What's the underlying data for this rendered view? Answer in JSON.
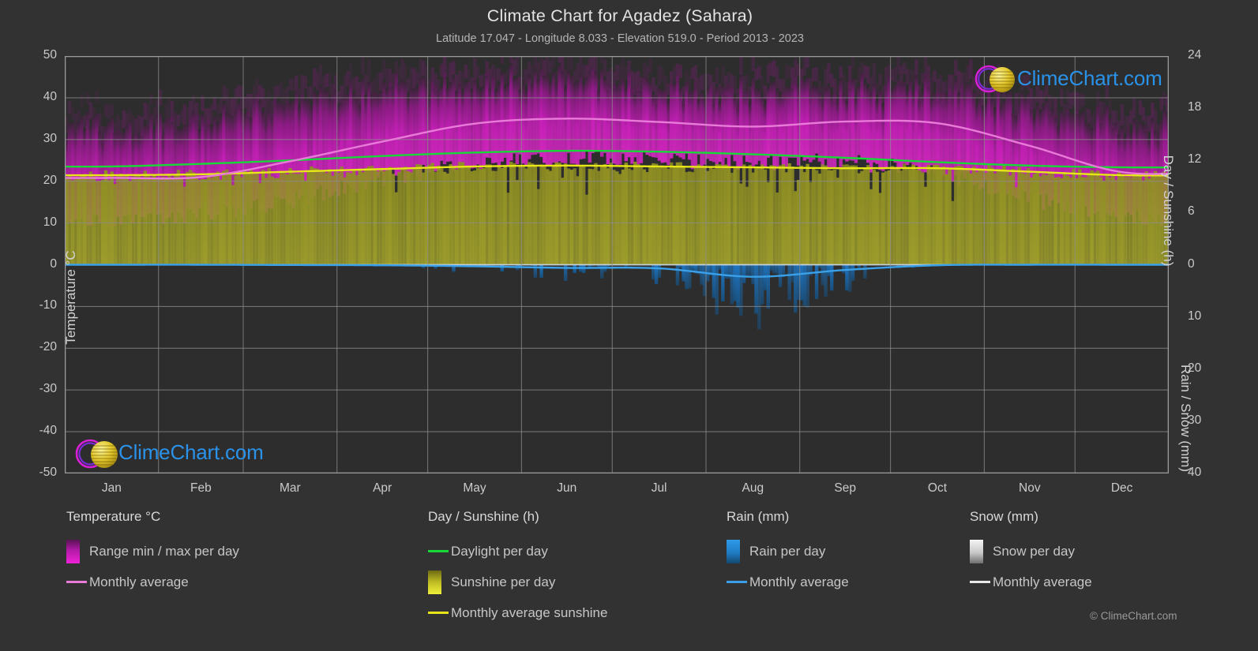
{
  "header": {
    "title": "Climate Chart for Agadez (Sahara)",
    "subtitle": "Latitude 17.047 - Longitude 8.033 - Elevation 519.0 - Period 2013 - 2023"
  },
  "axes": {
    "left_title": "Temperature °C",
    "right_top_title": "Day / Sunshine (h)",
    "right_bottom_title": "Rain / Snow (mm)",
    "left_ticks": [
      "50",
      "40",
      "30",
      "20",
      "10",
      "0",
      "-10",
      "-20",
      "-30",
      "-40",
      "-50"
    ],
    "right_top_ticks": [
      "24",
      "18",
      "12",
      "6",
      "0"
    ],
    "right_bottom_ticks": [
      "10",
      "20",
      "30",
      "40"
    ],
    "x_ticks": [
      "Jan",
      "Feb",
      "Mar",
      "Apr",
      "May",
      "Jun",
      "Jul",
      "Aug",
      "Sep",
      "Oct",
      "Nov",
      "Dec"
    ]
  },
  "legend": {
    "groups": [
      {
        "heading": "Temperature °C",
        "items": [
          {
            "label": "Range min / max per day",
            "swatch": "gradient-magenta",
            "type": "box"
          },
          {
            "label": "Monthly average",
            "swatch": "#e87ad8",
            "type": "line"
          }
        ]
      },
      {
        "heading": "Day / Sunshine (h)",
        "items": [
          {
            "label": "Daylight per day",
            "swatch": "#18d838",
            "type": "line"
          },
          {
            "label": "Sunshine per day",
            "swatch": "gradient-yellow",
            "type": "box"
          },
          {
            "label": "Monthly average sunshine",
            "swatch": "#e6e618",
            "type": "line"
          }
        ]
      },
      {
        "heading": "Rain (mm)",
        "items": [
          {
            "label": "Rain per day",
            "swatch": "gradient-blue",
            "type": "box"
          },
          {
            "label": "Monthly average",
            "swatch": "#3aa0e8",
            "type": "line"
          }
        ]
      },
      {
        "heading": "Snow (mm)",
        "items": [
          {
            "label": "Snow per day",
            "swatch": "gradient-white",
            "type": "box"
          },
          {
            "label": "Monthly average",
            "swatch": "#e8e8e8",
            "type": "line"
          }
        ]
      }
    ]
  },
  "branding": {
    "logo_text": "ClimeChart.com",
    "copyright": "© ClimeChart.com"
  },
  "colors": {
    "background": "#323232",
    "plot_background": "#2d2d2d",
    "grid": "#8c8c8c",
    "temp_range": "#cc22bb",
    "temp_avg_line": "#e87ad8",
    "daylight_line": "#18d838",
    "sunshine_fill": "#9a9a28",
    "sunshine_line": "#e6e618",
    "rain": "#1a7ac8",
    "rain_avg_line": "#3aa0e8",
    "snow": "#dcdcdc",
    "text": "#c8c8c8"
  },
  "chart_data": {
    "type": "area",
    "title": "Climate Chart for Agadez (Sahara)",
    "subtitle": "Latitude 17.047 - Longitude 8.033 - Elevation 519.0 - Period 2013 - 2023",
    "xlabel": "",
    "ylabel": "Temperature °C",
    "y2label_top": "Day / Sunshine (h)",
    "y2label_bottom": "Rain / Snow (mm)",
    "ylim": [
      -50,
      50
    ],
    "y2lim_top": [
      0,
      24
    ],
    "y2lim_bottom": [
      0,
      40
    ],
    "grid": true,
    "legend_position": "below",
    "categories": [
      "Jan",
      "Feb",
      "Mar",
      "Apr",
      "May",
      "Jun",
      "Jul",
      "Aug",
      "Sep",
      "Oct",
      "Nov",
      "Dec"
    ],
    "series": [
      {
        "name": "Monthly average temperature (°C)",
        "unit": "°C",
        "axis": "left",
        "values": [
          20.8,
          21.0,
          24.8,
          29.5,
          33.8,
          35.0,
          34.2,
          33.1,
          34.3,
          33.9,
          28.5,
          22.2
        ]
      },
      {
        "name": "Daily maximum temperature range top (°C)",
        "unit": "°C",
        "axis": "left",
        "values": [
          33.0,
          35.0,
          38.5,
          42.0,
          44.0,
          44.5,
          42.5,
          41.0,
          42.0,
          41.5,
          37.5,
          33.5
        ]
      },
      {
        "name": "Daily minimum temperature range bottom (°C)",
        "unit": "°C",
        "axis": "left",
        "values": [
          10.5,
          12.0,
          15.5,
          20.5,
          24.0,
          25.5,
          25.0,
          24.5,
          24.5,
          22.0,
          16.0,
          11.5
        ]
      },
      {
        "name": "Daylight per day (h)",
        "unit": "h",
        "axis": "right-top",
        "values": [
          11.3,
          11.6,
          12.0,
          12.5,
          12.9,
          13.1,
          13.0,
          12.7,
          12.3,
          11.8,
          11.4,
          11.2
        ]
      },
      {
        "name": "Monthly average sunshine (h)",
        "unit": "h",
        "axis": "right-top",
        "values": [
          10.3,
          10.4,
          10.7,
          11.0,
          11.3,
          11.4,
          11.3,
          11.2,
          11.1,
          11.1,
          10.7,
          10.3
        ]
      },
      {
        "name": "Monthly average rain (mm)",
        "unit": "mm",
        "axis": "right-bottom",
        "values": [
          0.0,
          0.0,
          0.05,
          0.1,
          0.3,
          0.6,
          0.7,
          2.3,
          1.0,
          0.1,
          0.0,
          0.0
        ]
      },
      {
        "name": "Monthly average snow (mm)",
        "unit": "mm",
        "axis": "right-bottom",
        "values": [
          0.0,
          0.0,
          0.0,
          0.0,
          0.0,
          0.0,
          0.0,
          0.0,
          0.0,
          0.0,
          0.0,
          0.0
        ]
      }
    ],
    "notes": "Daily min/max temperature shown as magenta band; daily sunshine shown as olive bars; daily rain shown as blue bars below zero line."
  }
}
